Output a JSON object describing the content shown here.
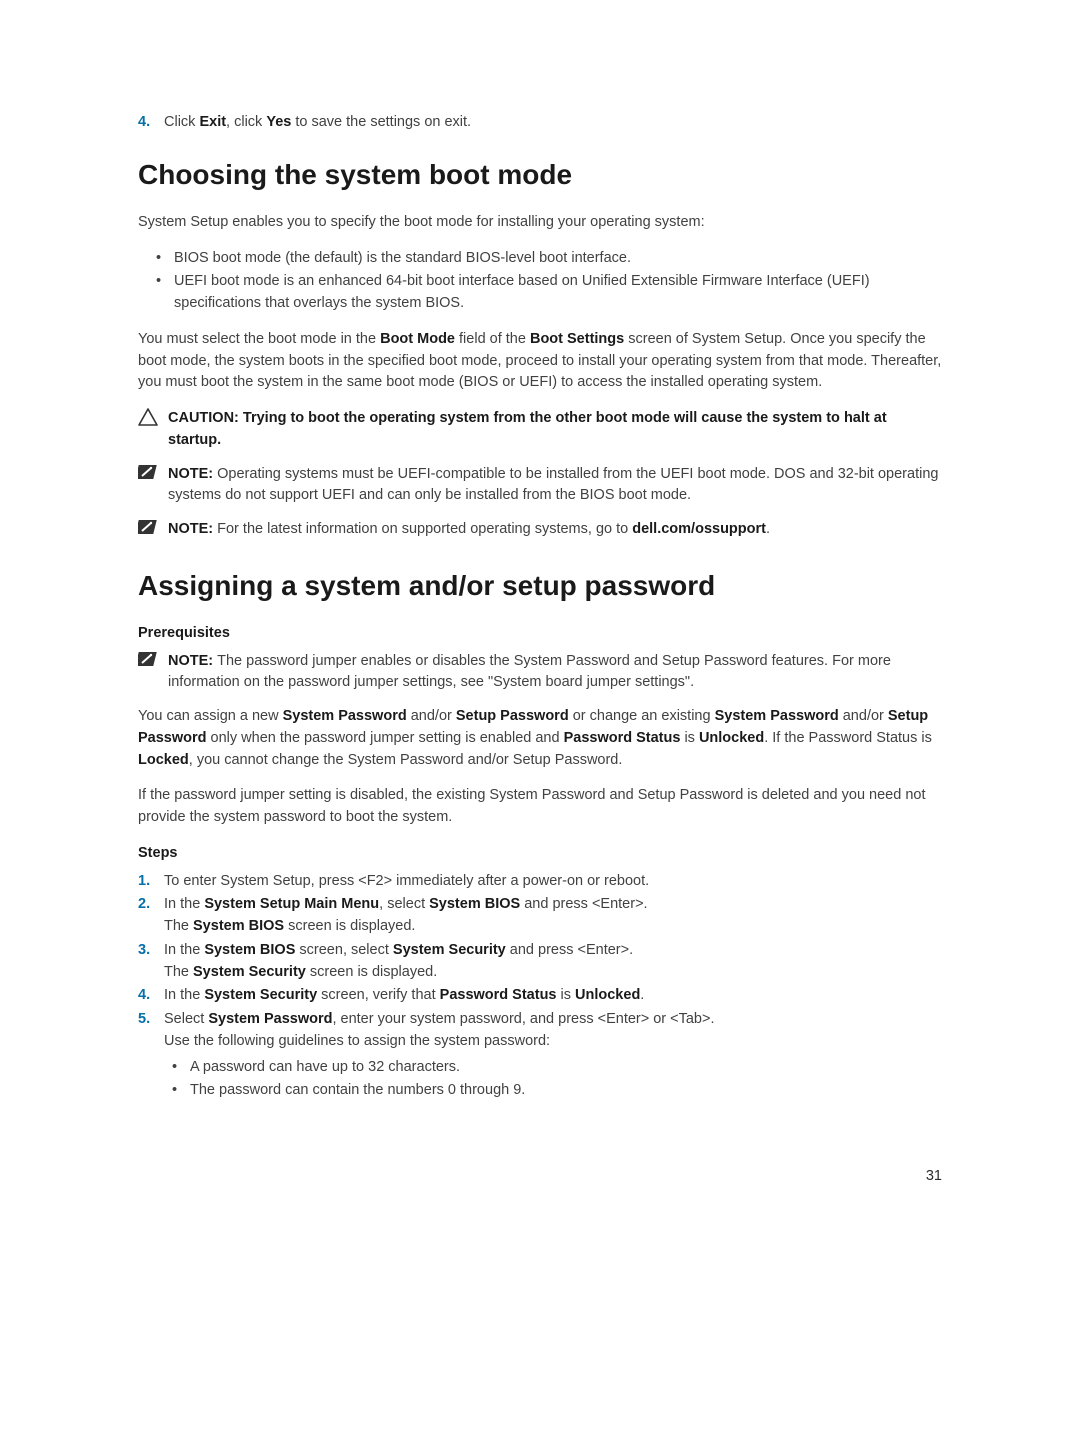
{
  "step4": {
    "num": "4.",
    "pre": "Click ",
    "exit": "Exit",
    "mid": ", click ",
    "yes": "Yes",
    "post": " to save the settings on exit."
  },
  "h1a": "Choosing the system boot mode",
  "p1": "System Setup enables you to specify the boot mode for installing your operating system:",
  "bullets1": [
    "BIOS boot mode (the default) is the standard BIOS-level boot interface.",
    "UEFI boot mode is an enhanced 64-bit boot interface based on Unified Extensible Firmware Interface (UEFI) specifications that overlays the system BIOS."
  ],
  "p2": {
    "a": "You must select the boot mode in the ",
    "b": "Boot Mode",
    "c": " field of the ",
    "d": "Boot Settings",
    "e": " screen of System Setup. Once you specify the boot mode, the system boots in the specified boot mode, proceed to install your operating system from that mode. Thereafter, you must boot the system in the same boot mode (BIOS or UEFI) to access the installed operating system."
  },
  "caution": {
    "label": "CAUTION: ",
    "text": "Trying to boot the operating system from the other boot mode will cause the system to halt at startup."
  },
  "note1": {
    "label": "NOTE: ",
    "text": "Operating systems must be UEFI-compatible to be installed from the UEFI boot mode. DOS and 32-bit operating systems do not support UEFI and can only be installed from the BIOS boot mode."
  },
  "note2": {
    "label": "NOTE: ",
    "pre": "For the latest information on supported operating systems, go to ",
    "link": "dell.com/ossupport",
    "post": "."
  },
  "h1b": "Assigning a system and/or setup password",
  "prereq": "Prerequisites",
  "note3": {
    "label": "NOTE: ",
    "text": "The password jumper enables or disables the System Password and Setup Password features. For more information on the password jumper settings, see \"System board jumper settings\"."
  },
  "p3": {
    "a": "You can assign a new ",
    "b": "System Password",
    "c": " and/or ",
    "d": "Setup Password",
    "e": " or change an existing ",
    "f": "System Password",
    "g": " and/or ",
    "h": "Setup Password",
    "i": " only when the password jumper setting is enabled and ",
    "j": "Password Status",
    "k": " is ",
    "l": "Unlocked",
    "m": ". If the Password Status is ",
    "n": "Locked",
    "o": ", you cannot change the System Password and/or Setup Password."
  },
  "p4": "If the password jumper setting is disabled, the existing System Password and Setup Password is deleted and you need not provide the system password to boot the system.",
  "stepsLabel": "Steps",
  "steps": {
    "s1": {
      "num": "1.",
      "text": "To enter System Setup, press <F2> immediately after a power-on or reboot."
    },
    "s2": {
      "num": "2.",
      "a": "In the ",
      "b": "System Setup Main Menu",
      "c": ", select ",
      "d": "System BIOS",
      "e": " and press <Enter>.",
      "f": "The ",
      "g": "System BIOS",
      "h": " screen is displayed."
    },
    "s3": {
      "num": "3.",
      "a": "In the ",
      "b": "System BIOS",
      "c": " screen, select ",
      "d": "System Security",
      "e": " and press <Enter>.",
      "f": "The ",
      "g": "System Security",
      "h": " screen is displayed."
    },
    "s4": {
      "num": "4.",
      "a": "In the ",
      "b": "System Security",
      "c": " screen, verify that ",
      "d": "Password Status",
      "e": " is ",
      "f": "Unlocked",
      "g": "."
    },
    "s5": {
      "num": "5.",
      "a": "Select ",
      "b": "System Password",
      "c": ", enter your system password, and press <Enter> or <Tab>.",
      "d": "Use the following guidelines to assign the system password:",
      "bullets": [
        "A password can have up to 32 characters.",
        "The password can contain the numbers 0 through 9."
      ]
    }
  },
  "pageNum": "31"
}
